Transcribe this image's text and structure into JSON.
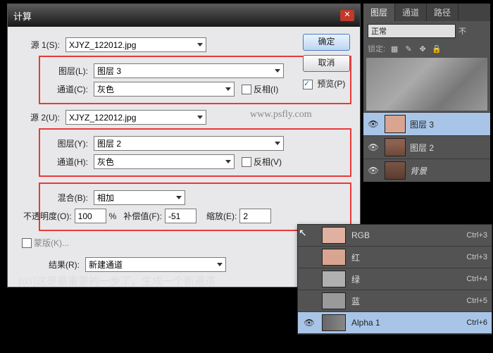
{
  "dialog": {
    "title": "计算",
    "buttons": {
      "ok": "确定",
      "cancel": "取消"
    },
    "preview": {
      "label": "预览(P)",
      "checked": true
    },
    "source1": {
      "label": "源 1(S):",
      "file": "XJYZ_122012.jpg",
      "layer_label": "图层(L):",
      "layer": "图层 3",
      "channel_label": "通道(C):",
      "channel": "灰色",
      "invert_label": "反相(I)"
    },
    "source2": {
      "label": "源 2(U):",
      "file": "XJYZ_122012.jpg",
      "layer_label": "图层(Y):",
      "layer": "图层 2",
      "channel_label": "通道(H):",
      "channel": "灰色",
      "invert_label": "反相(V)"
    },
    "blending": {
      "label": "混合(B):",
      "mode": "相加",
      "opacity_label": "不透明度(O):",
      "opacity": "100",
      "percent": "%",
      "offset_label": "补偿值(F):",
      "offset": "-51",
      "scale_label": "缩放(E):",
      "scale": "2",
      "mask_label": "蒙版(K)..."
    },
    "result": {
      "label": "结果(R):",
      "value": "新建通道"
    }
  },
  "caption": "[03]这是最重要的一步了，生成一个新通道",
  "watermark": "www.psfly.com",
  "layers_panel": {
    "tabs": {
      "layers": "图层",
      "channels": "通道",
      "paths": "路径"
    },
    "mode": "正常",
    "lock_label": "锁定:",
    "items": [
      {
        "name": "图层 3",
        "visible": true,
        "selected": true,
        "thumb": "skin"
      },
      {
        "name": "图层 2",
        "visible": true,
        "selected": false,
        "thumb": "face"
      },
      {
        "name": "背景",
        "visible": true,
        "selected": false,
        "thumb": "bg"
      }
    ]
  },
  "channels_panel": {
    "items": [
      {
        "name": "RGB",
        "shortcut": "Ctrl+3",
        "visible": false,
        "thumb": "rgb"
      },
      {
        "name": "红",
        "shortcut": "Ctrl+3",
        "visible": false,
        "thumb": "red"
      },
      {
        "name": "绿",
        "shortcut": "Ctrl+4",
        "visible": false,
        "thumb": "green"
      },
      {
        "name": "蓝",
        "shortcut": "Ctrl+5",
        "visible": false,
        "thumb": "blue"
      },
      {
        "name": "Alpha 1",
        "shortcut": "Ctrl+6",
        "visible": true,
        "thumb": "alpha",
        "selected": true
      }
    ]
  }
}
